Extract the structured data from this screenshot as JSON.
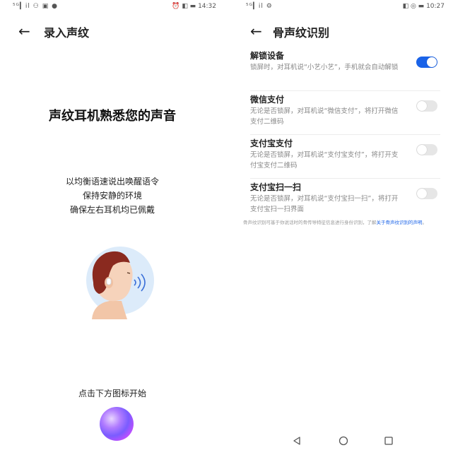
{
  "left": {
    "status": {
      "left": "⁵ᴳ▎il ⚇ ▣ ●",
      "time": "14:32",
      "right_icons": "⏰ ◧ ▬"
    },
    "header": {
      "title": "录入声纹"
    },
    "headline": "声纹耳机熟悉您的声音",
    "instructions": [
      "以均衡语速说出唤醒语令",
      "保持安静的环境",
      "确保左右耳机均已佩戴"
    ],
    "start_hint": "点击下方图标开始"
  },
  "right": {
    "status": {
      "left": "⁵ᴳ▎il ⚙",
      "time": "10:27",
      "right_icons": "◧ ◎ ▬"
    },
    "header": {
      "title": "骨声纹识别"
    },
    "settings": [
      {
        "title": "解锁设备",
        "desc": "锁屏时，对耳机说“小艺小艺”，手机就会自动解锁",
        "enabled": true
      },
      {
        "title": "微信支付",
        "desc": "无论是否锁屏，对耳机说“微信支付”，将打开微信支付二维码",
        "enabled": false
      },
      {
        "title": "支付宝支付",
        "desc": "无论是否锁屏，对耳机说“支付宝支付”，将打开支付宝支付二维码",
        "enabled": false
      },
      {
        "title": "支付宝扫一扫",
        "desc": "无论是否锁屏，对耳机说“支付宝扫一扫”，将打开支付宝扫一扫界面",
        "enabled": false
      }
    ],
    "footnote": {
      "text": "骨声纹识别可基于你说话时的骨传导特征信息进行身份识别，了解",
      "link": "关于骨声纹识别的声明",
      "end": "。"
    }
  },
  "colors": {
    "accent": "#1a63e8",
    "toggle_off": "#e6e6e6"
  }
}
